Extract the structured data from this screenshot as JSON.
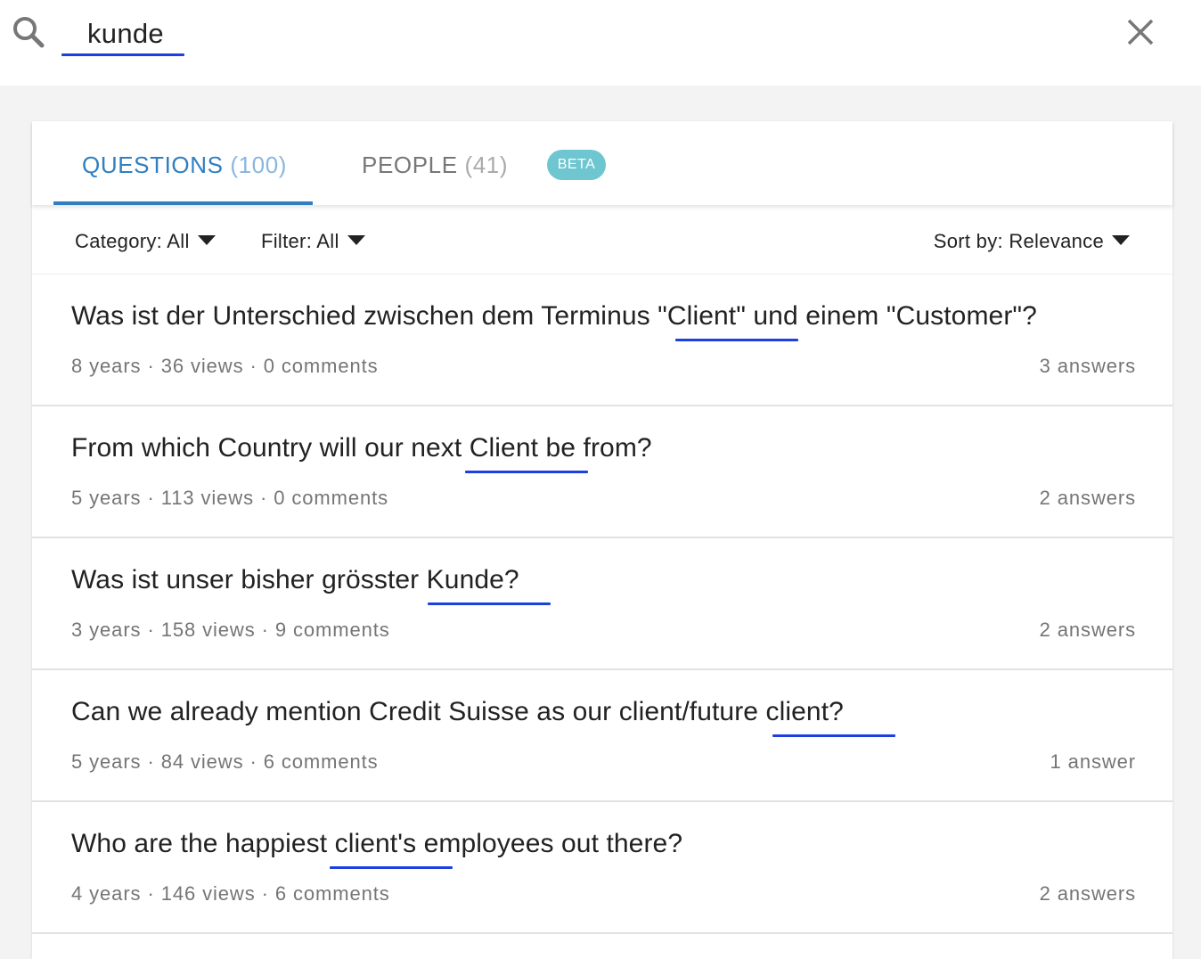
{
  "search": {
    "query": "kunde",
    "search_icon": "search-icon",
    "close_icon": "close-icon"
  },
  "tabs": [
    {
      "label": "QUESTIONS",
      "count": "(100)",
      "active": true
    },
    {
      "label": "PEOPLE",
      "count": "(41)",
      "active": false
    }
  ],
  "beta_badge": "BETA",
  "filters": {
    "category": "Category: All",
    "filter": "Filter: All",
    "sort": "Sort by: Relevance"
  },
  "results": [
    {
      "title": "Was ist der Unterschied zwischen dem Terminus \"Client\" und einem \"Customer\"?",
      "meta": "8 years · 36 views · 0 comments",
      "answers": "3 answers"
    },
    {
      "title": "From which Country will our next Client be from?",
      "meta": "5 years · 113 views · 0 comments",
      "answers": "2 answers"
    },
    {
      "title": "Was ist unser bisher grösster Kunde?",
      "meta": "3 years · 158 views · 9 comments",
      "answers": "2 answers"
    },
    {
      "title": "Can we already mention Credit Suisse as our client/future client?",
      "meta": "5 years · 84 views · 6 comments",
      "answers": "1 answer"
    },
    {
      "title": "Who are the happiest client's employees out there?",
      "meta": "4 years · 146 views · 6 comments",
      "answers": "2 answers"
    }
  ],
  "colors": {
    "accent": "#2f7fc1",
    "highlight": "#1d3fe0",
    "beta": "#6ec6d0"
  }
}
